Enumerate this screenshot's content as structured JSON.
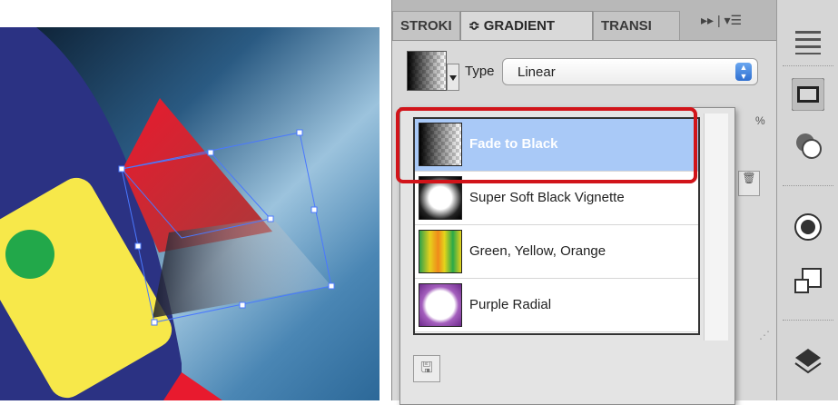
{
  "tabs": [
    {
      "label": "STROKI",
      "active": false
    },
    {
      "label": "≎ GRADIENT",
      "active": true
    },
    {
      "label": "TRANSI",
      "active": false
    }
  ],
  "tabbar_controls": "▸▸ | ▾☰",
  "type_label": "Type",
  "type_value": "Linear",
  "percent_symbol": "%",
  "presets": [
    {
      "label": "Fade to Black",
      "selected": true
    },
    {
      "label": "Super Soft Black Vignette",
      "selected": false
    },
    {
      "label": "Green, Yellow, Orange",
      "selected": false
    },
    {
      "label": "Purple Radial",
      "selected": false
    }
  ],
  "highlight_color": "#d1141a",
  "selected_row_color": "#a9c9f7",
  "icons": [
    "stroke-icon",
    "gradient-swatch-icon",
    "transparency-icon",
    "radial-icon",
    "transform-icon",
    "layers-icon",
    "save-icon",
    "trash-icon"
  ]
}
